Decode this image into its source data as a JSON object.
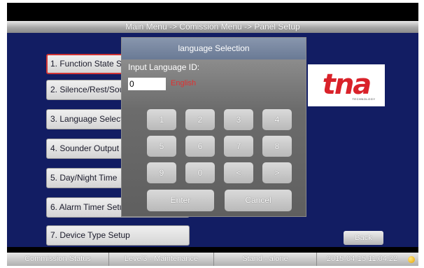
{
  "header": {
    "breadcrumb": "Main Menu -> Comission Menu -> Panel Setup"
  },
  "menu": {
    "items": [
      {
        "label": "1. Function State Setup",
        "active": true
      },
      {
        "label": "2. Silence/Rest/Sounder"
      },
      {
        "label": "3. Language Selection"
      },
      {
        "label": "4. Sounder Output"
      },
      {
        "label": "5. Day/Night Time"
      },
      {
        "label": "6. Alarm Timer Setup"
      },
      {
        "label": "7. Device Type Setup"
      }
    ]
  },
  "logo": {
    "text": "tna",
    "subtext": "TECHNOLOGY"
  },
  "back_button": {
    "label": "Back"
  },
  "dialog": {
    "title": "language Selection",
    "input_label": "Input Language ID:",
    "input_value": "0",
    "language_name": "English",
    "keys": [
      "1",
      "2",
      "3",
      "4",
      "5",
      "6",
      "7",
      "8",
      "9",
      "0",
      "<",
      ">"
    ],
    "enter_label": "Enter",
    "cancel_label": "Cancel"
  },
  "status_bar": {
    "status": "Commission Status",
    "level": "Level3 - Maintenance",
    "mode": "Stand - alone",
    "datetime": "2015-04-15 11:04:22"
  },
  "colors": {
    "background": "#121d63",
    "accent_red": "#d9222a",
    "status_dot": "#e7a400"
  }
}
